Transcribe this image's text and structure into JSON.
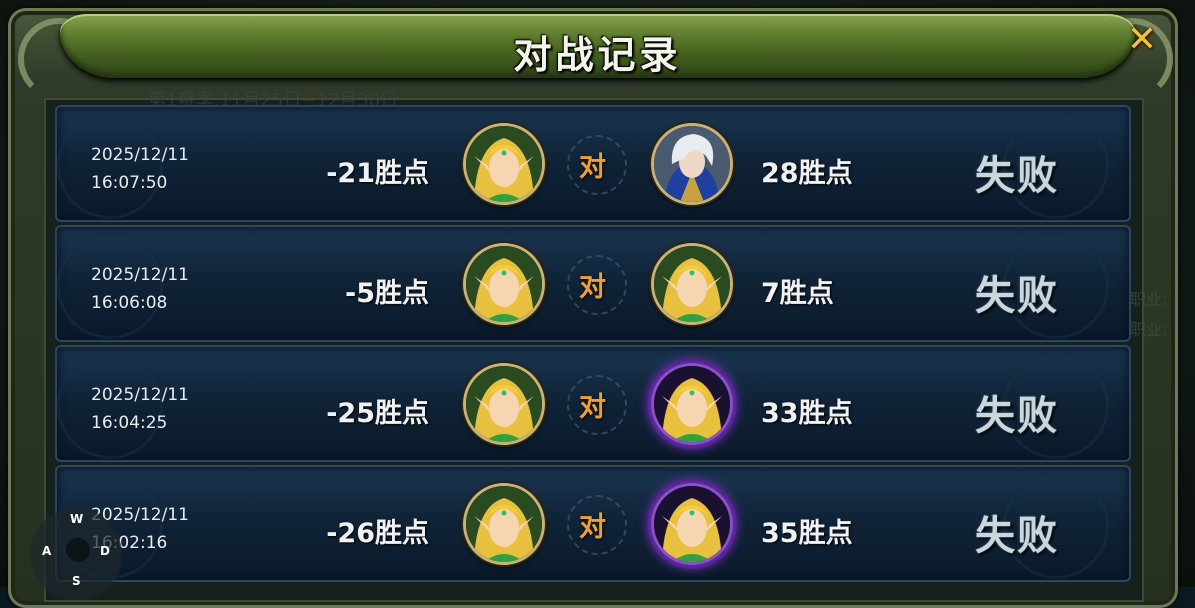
{
  "window": {
    "title": "对战记录",
    "close_icon": "close-x-icon"
  },
  "background_text": {
    "season": "第1赛季:11月25日~12月30日",
    "side1": "职业:",
    "side2": "职业:"
  },
  "records": [
    {
      "date": "2025/12/11",
      "time": "16:07:50",
      "my_points": "-21胜点",
      "vs": "对",
      "opp_points": "28胜点",
      "result": "失败",
      "opp_avatar": "white-hair-warrior"
    },
    {
      "date": "2025/12/11",
      "time": "16:06:08",
      "my_points": "-5胜点",
      "vs": "对",
      "opp_points": "7胜点",
      "result": "失败",
      "opp_avatar": "elf-archer"
    },
    {
      "date": "2025/12/11",
      "time": "16:04:25",
      "my_points": "-25胜点",
      "vs": "对",
      "opp_points": "33胜点",
      "result": "失败",
      "opp_avatar": "elf-archer-purple-frame"
    },
    {
      "date": "2025/12/11",
      "time": "16:02:16",
      "my_points": "-26胜点",
      "vs": "对",
      "opp_points": "35胜点",
      "result": "失败",
      "opp_avatar": "elf-archer-purple-frame"
    }
  ],
  "dpad": {
    "up": "W",
    "left": "A",
    "right": "D",
    "down": "S"
  },
  "colors": {
    "accent_gold": "#f0a030",
    "title_green": "#5c7a2c",
    "result_gray": "#c9d6dc"
  }
}
